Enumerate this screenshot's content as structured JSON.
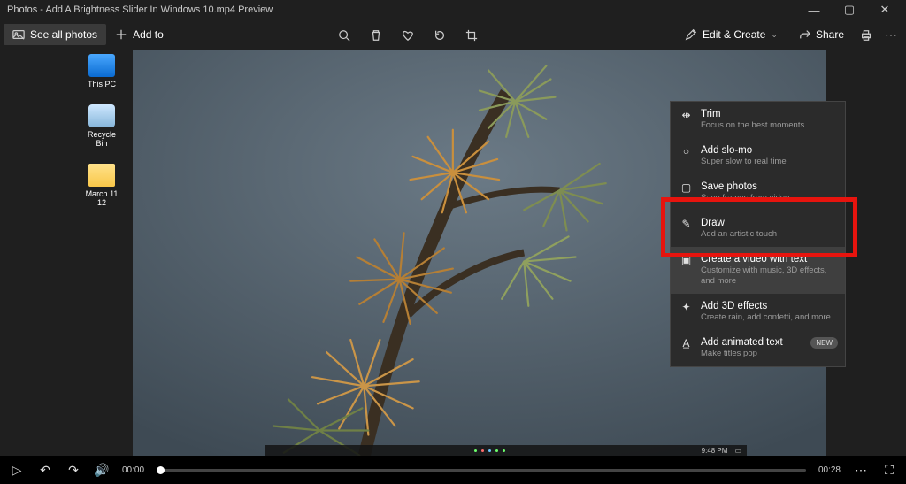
{
  "titlebar": {
    "title": "Photos - Add A Brightness Slider In Windows 10.mp4 Preview"
  },
  "toolbar": {
    "see_all": "See all photos",
    "add_to": "Add to",
    "edit_create": "Edit & Create",
    "share": "Share"
  },
  "desktop_icons": [
    {
      "label": "This PC"
    },
    {
      "label": "Recycle Bin"
    },
    {
      "label": "March 11 12"
    }
  ],
  "dropdown": {
    "items": [
      {
        "title": "Trim",
        "sub": "Focus on the best moments"
      },
      {
        "title": "Add slo-mo",
        "sub": "Super slow to real time"
      },
      {
        "title": "Save photos",
        "sub": "Save frames from video"
      },
      {
        "title": "Draw",
        "sub": "Add an artistic touch"
      },
      {
        "title": "Create a video with text",
        "sub": "Customize with music, 3D effects, and more"
      },
      {
        "title": "Add 3D effects",
        "sub": "Create rain, add confetti, and more"
      },
      {
        "title": "Add animated text",
        "sub": "Make titles pop",
        "badge": "NEW"
      }
    ]
  },
  "player": {
    "current": "00:00",
    "total": "00:28"
  },
  "taskbar": {
    "time": "9:48 PM"
  }
}
